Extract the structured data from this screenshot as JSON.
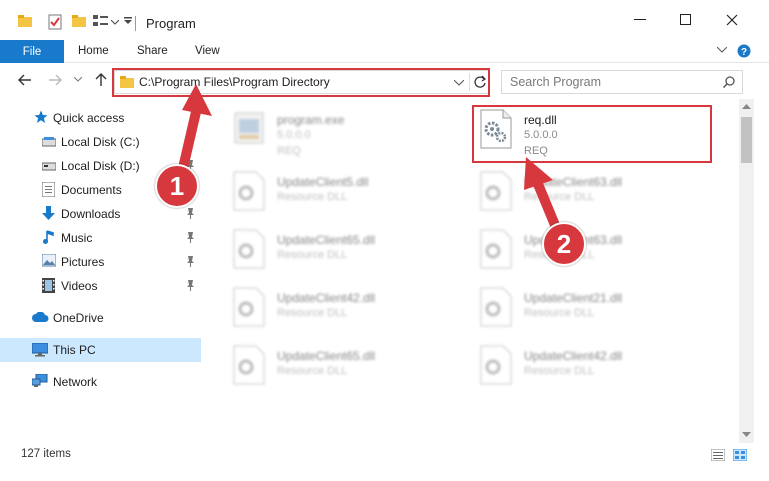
{
  "window": {
    "title": "Program"
  },
  "ribbon": {
    "tabs": [
      "File",
      "Home",
      "Share",
      "View"
    ]
  },
  "address": {
    "path": "C:\\Program Files\\Program Directory"
  },
  "search": {
    "placeholder": "Search Program"
  },
  "sidebar": {
    "items": [
      {
        "label": "Quick access",
        "icon": "star-icon"
      },
      {
        "label": "Local Disk (C:)",
        "icon": "drive-icon"
      },
      {
        "label": "Local Disk (D:)",
        "icon": "drive-icon"
      },
      {
        "label": "Documents",
        "icon": "documents-icon"
      },
      {
        "label": "Downloads",
        "icon": "download-icon"
      },
      {
        "label": "Music",
        "icon": "music-icon"
      },
      {
        "label": "Pictures",
        "icon": "pictures-icon"
      },
      {
        "label": "Videos",
        "icon": "videos-icon"
      },
      {
        "label": "OneDrive",
        "icon": "cloud-icon"
      },
      {
        "label": "This PC",
        "icon": "pc-icon"
      },
      {
        "label": "Network",
        "icon": "network-icon"
      }
    ]
  },
  "files": [
    {
      "name": "program.exe",
      "line2": "5.0.0.0",
      "line3": "REQ",
      "blurred": true
    },
    {
      "name": "req.dll",
      "line2": "5.0.0.0",
      "line3": "REQ",
      "blurred": false
    },
    {
      "name": "UpdateClient5.dll",
      "line2": "Resource DLL",
      "line3": "",
      "blurred": true
    },
    {
      "name": "UpdateClient63.dll",
      "line2": "Resource DLL",
      "line3": "",
      "blurred": true
    },
    {
      "name": "UpdateClient65.dll",
      "line2": "Resource DLL",
      "line3": "",
      "blurred": true
    },
    {
      "name": "UpdateClient63.dll",
      "line2": "Resource DLL",
      "line3": "",
      "blurred": true
    },
    {
      "name": "UpdateClient42.dll",
      "line2": "Resource DLL",
      "line3": "",
      "blurred": true
    },
    {
      "name": "UpdateClient21.dll",
      "line2": "Resource DLL",
      "line3": "",
      "blurred": true
    },
    {
      "name": "UpdateClient65.dll",
      "line2": "Resource DLL",
      "line3": "",
      "blurred": true
    },
    {
      "name": "UpdateClient42.dll",
      "line2": "Resource DLL",
      "line3": "",
      "blurred": true
    }
  ],
  "status": {
    "item_count": "127 items"
  },
  "annotations": {
    "step1": "1",
    "step2": "2",
    "color": "#d7383e"
  },
  "colors": {
    "accent": "#1979ca",
    "selected": "#cce8ff"
  }
}
